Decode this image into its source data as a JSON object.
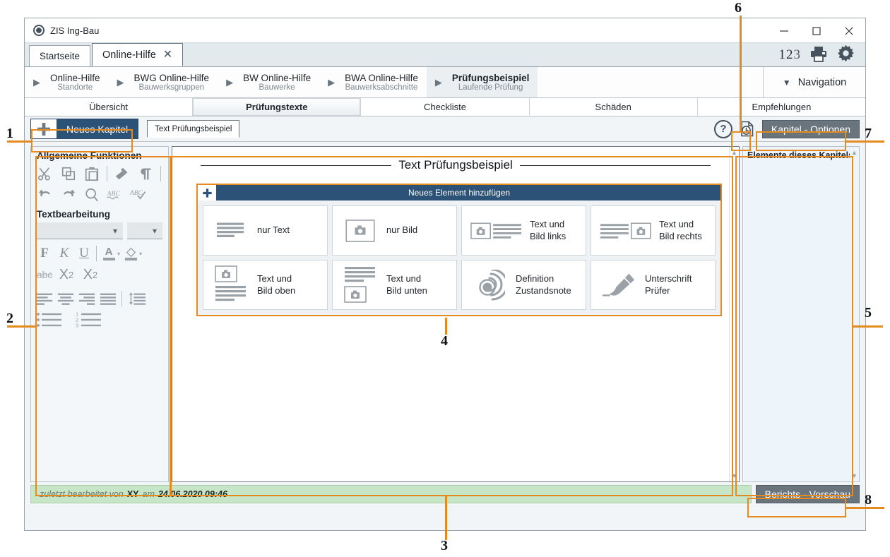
{
  "window": {
    "title": "ZIS Ing-Bau",
    "app_icon": "circle-app-icon",
    "controls": {
      "minimize": "minimize-icon",
      "maximize": "maximize-icon",
      "close": "close-icon"
    }
  },
  "tabstrip": {
    "tabs": [
      {
        "label": "Startseite",
        "active": false,
        "closable": false
      },
      {
        "label": "Online-Hilfe",
        "active": true,
        "closable": true
      }
    ],
    "numbers": "123",
    "num_a": "1",
    "num_b": "2",
    "num_c": "3",
    "print_icon": "printer-icon",
    "settings_icon": "gear-icon"
  },
  "breadcrumb": {
    "items": [
      {
        "title": "Online-Hilfe",
        "subtitle": "Standorte",
        "current": false
      },
      {
        "title": "BWG Online-Hilfe",
        "subtitle": "Bauwerksgruppen",
        "current": false
      },
      {
        "title": "BW Online-Hilfe",
        "subtitle": "Bauwerke",
        "current": false
      },
      {
        "title": "BWA Online-Hilfe",
        "subtitle": "Bauwerksabschnitte",
        "current": false
      },
      {
        "title": "Prüfungsbeispiel",
        "subtitle": "Laufende Prüfung",
        "current": true
      }
    ],
    "nav_label": "Navigation",
    "nav_icon": "chevron-down-icon"
  },
  "section_tabs": [
    {
      "label": "Übersicht",
      "active": false
    },
    {
      "label": "Prüfungstexte",
      "active": true
    },
    {
      "label": "Checkliste",
      "active": false
    },
    {
      "label": "Schäden",
      "active": false
    },
    {
      "label": "Empfehlungen",
      "active": false
    }
  ],
  "action_row": {
    "new_chapter_label": "Neues Kapitel",
    "new_chapter_icon": "plus-icon",
    "doc_tab_label": "Text Prüfungsbeispiel",
    "help_label": "?",
    "help_icon": "question-mark-icon",
    "history_icon": "document-history-icon",
    "options_label": "Kapitel - Optionen"
  },
  "left_toolbar": {
    "group1_title": "Allgemeine Funktionen",
    "row1_icons": [
      "scissors-icon",
      "copy-icon",
      "paste-icon",
      "format-painter-icon",
      "pilcrow-icon"
    ],
    "row2_icons": [
      "undo-icon",
      "redo-icon",
      "search-icon",
      "spellcheck-icon",
      "spellcheck-ok-icon"
    ],
    "group2_title": "Textbearbeitung",
    "font_select_value": "",
    "size_select_value": "",
    "format_icons_row1": [
      "bold-icon",
      "italic-icon",
      "underline-icon",
      "font-color-icon",
      "highlight-color-icon"
    ],
    "bold_glyph": "F",
    "italic_glyph": "K",
    "underline_glyph": "U",
    "fontcolor_glyph": "A",
    "format_icons_row2": [
      "strikethrough-icon",
      "subscript-icon",
      "superscript-icon"
    ],
    "strike_glyph": "abc",
    "sub_glyph": "X2",
    "sup_glyph": "X2",
    "align_icons": [
      "align-left-icon",
      "align-center-icon",
      "align-right-icon",
      "align-justify-icon",
      "line-spacing-icon"
    ],
    "list_icons": [
      "bullet-list-icon",
      "numbered-list-icon"
    ]
  },
  "editor": {
    "document_title": "Text Prüfungsbeispiel",
    "add_element_label": "Neues Element hinzufügen",
    "add_element_icon": "plus-icon",
    "cards": [
      {
        "label": "nur Text",
        "icon": "text-lines-icon"
      },
      {
        "label": "nur Bild",
        "icon": "camera-icon"
      },
      {
        "label": "Text und\nBild links",
        "line1": "Text und",
        "line2": "Bild links",
        "icon": "camera-left-text-icon"
      },
      {
        "label": "Text und\nBild rechts",
        "line1": "Text und",
        "line2": "Bild rechts",
        "icon": "text-left-camera-icon"
      },
      {
        "label": "Text und\nBild oben",
        "line1": "Text und",
        "line2": "Bild oben",
        "icon": "camera-top-text-icon"
      },
      {
        "label": "Text und\nBild unten",
        "line1": "Text und",
        "line2": "Bild unten",
        "icon": "text-top-camera-icon"
      },
      {
        "label": "Definition\nZustandsnote",
        "line1": "Definition",
        "line2": "Zustandsnote",
        "icon": "condition-rating-icon"
      },
      {
        "label": "Unterschrift\nPrüfer",
        "line1": "Unterschrift",
        "line2": "Prüfer",
        "icon": "signature-pen-icon"
      }
    ],
    "scroll_up_icon": "scroll-up-arrow-icon",
    "scroll_down_icon": "scroll-down-arrow-icon"
  },
  "right_panel": {
    "title": "Elemente dieses Kapitels",
    "scroll_up_icon": "scroll-up-arrow-icon",
    "scroll_down_icon": "scroll-down-arrow-icon"
  },
  "footer": {
    "status_prefix": "zuletzt bearbeitet von",
    "status_user": "XY",
    "status_mid": "am",
    "status_date": "24.06.2020 09:46",
    "preview_label": "Berichts - Vorschau"
  },
  "annotations": {
    "n1": "1",
    "n2": "2",
    "n3": "3",
    "n4": "4",
    "n5": "5",
    "n6": "6",
    "n7": "7",
    "n8": "8",
    "color": "#e58a1f"
  }
}
